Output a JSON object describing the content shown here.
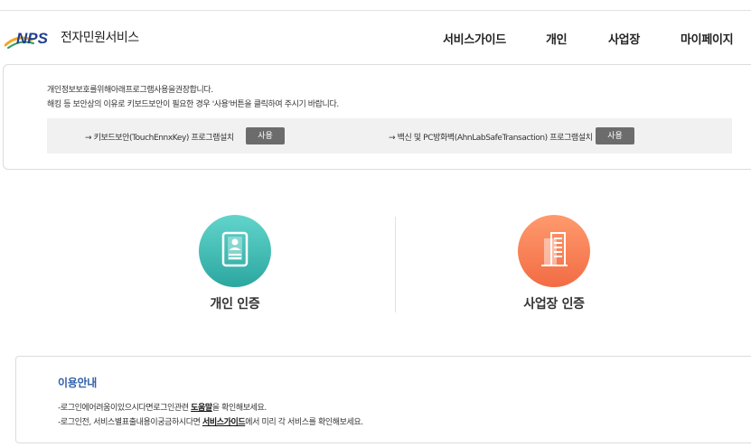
{
  "header": {
    "logo_brand": "NPS",
    "logo_text": "전자민원서비스",
    "colors": {
      "logo_blue": "#1f3f8f",
      "logo_orange": "#f5a623"
    },
    "nav": [
      "서비스가이드",
      "개인",
      "사업장",
      "마이페이지"
    ]
  },
  "notice": {
    "lines": [
      "개인정보보호를위해아래프로그램사용을권장합니다.",
      "해킹 등 보안상의 이유로 키보드보안이 필요한 경우 '사용'버튼을 클릭하여 주시기 바랍니다."
    ],
    "installs": [
      {
        "text": "→ 키보드보안(TouchEnnxKey) 프로그램설치",
        "button": "사용"
      },
      {
        "text": "→ 백신 및 PC방화벽(AhnLabSafeTransaction) 프로그램설치",
        "button": "사용"
      }
    ]
  },
  "certs": [
    {
      "label": "개인 인증",
      "icon": "id-card-icon",
      "color": "#3bb8b0"
    },
    {
      "label": "사업장 인증",
      "icon": "building-icon",
      "color": "#f7804f"
    }
  ],
  "guide": {
    "title": "이용안내",
    "line1_prefix": "-로그인에어려움이있으시다면로그인관련 ",
    "line1_link": "도움말",
    "line1_suffix": "을 확인해보세요.",
    "line2_prefix": "-로그인전, 서비스별표출내용이궁금하시다면 ",
    "line2_link": "서비스가이드",
    "line2_suffix": "에서 미리 각 서비스를 확인해보세요."
  }
}
